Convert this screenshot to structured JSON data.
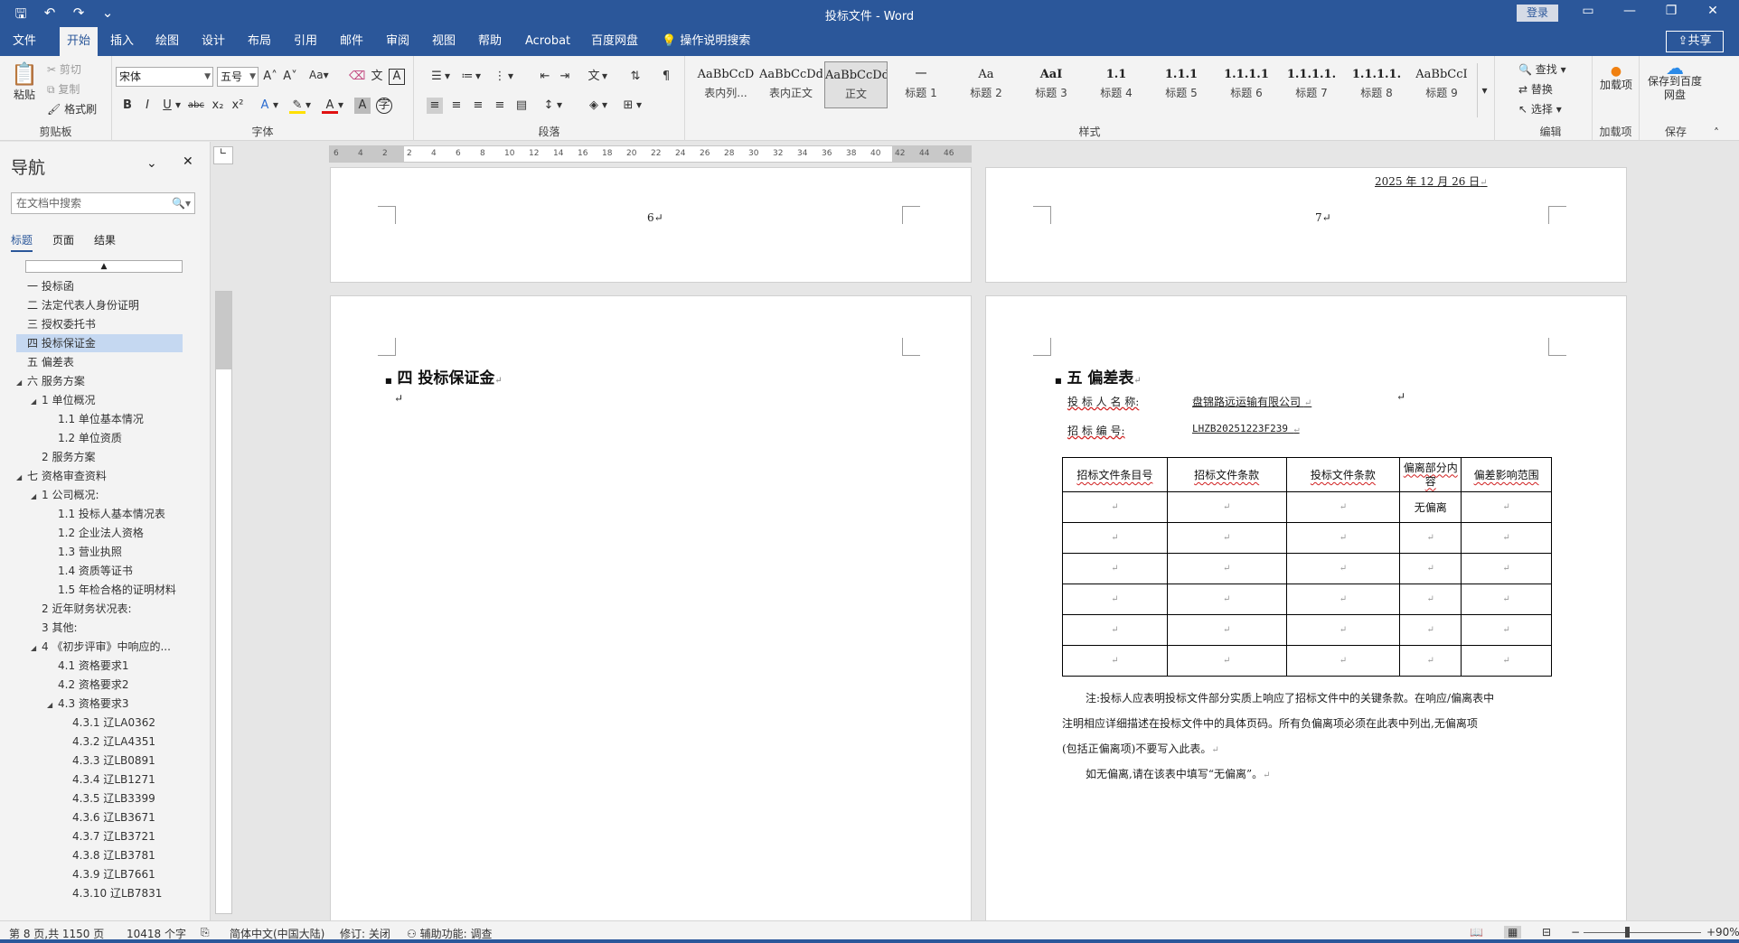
{
  "titlebar": {
    "title": "投标文件 - Word",
    "login_label": "登录",
    "qat_icons": [
      "save-icon",
      "undo-icon",
      "redo-icon",
      "customize-icon"
    ]
  },
  "tabs": {
    "items": [
      "文件",
      "开始",
      "插入",
      "绘图",
      "设计",
      "布局",
      "引用",
      "邮件",
      "审阅",
      "视图",
      "帮助",
      "Acrobat",
      "百度网盘"
    ],
    "active": "开始",
    "search_label": "操作说明搜索",
    "share_label": "共享"
  },
  "ribbon": {
    "clipboard": {
      "paste": "粘贴",
      "cut": "剪切",
      "copy": "复制",
      "format_painter": "格式刷",
      "label": "剪贴板"
    },
    "font": {
      "name": "宋体",
      "size": "五号",
      "label": "字体",
      "change_case": "Aa"
    },
    "paragraph": {
      "label": "段落"
    },
    "styles": {
      "label": "样式",
      "items": [
        {
          "sample": "AaBbCcD",
          "name": "表内列..."
        },
        {
          "sample": "AaBbCcDdI",
          "name": "表内正文"
        },
        {
          "sample": "AaBbCcDdI",
          "name": "正文"
        },
        {
          "sample": "一",
          "name": "标题 1"
        },
        {
          "sample": "Aa",
          "name": "标题 2"
        },
        {
          "sample": "AaI",
          "name": "标题 3"
        },
        {
          "sample": "1.1",
          "name": "标题 4"
        },
        {
          "sample": "1.1.1",
          "name": "标题 5"
        },
        {
          "sample": "1.1.1.1",
          "name": "标题 6"
        },
        {
          "sample": "1.1.1.1.",
          "name": "标题 7"
        },
        {
          "sample": "1.1.1.1.",
          "name": "标题 8"
        },
        {
          "sample": "AaBbCcI",
          "name": "标题 9"
        },
        {
          "sample": "AaBbCcDc",
          "name": ""
        }
      ]
    },
    "editing": {
      "find": "查找",
      "replace": "替换",
      "select": "选择",
      "label": "编辑"
    },
    "addin": {
      "add": "加载项",
      "label": "加载项"
    },
    "save": {
      "save_to_baidu": "保存到百度网盘",
      "label": "保存"
    }
  },
  "nav": {
    "title": "导航",
    "search_placeholder": "在文档中搜索",
    "tabs": [
      "标题",
      "页面",
      "结果"
    ],
    "items": [
      {
        "text": "一 投标函",
        "level": 0,
        "tri": ""
      },
      {
        "text": "二 法定代表人身份证明",
        "level": 0,
        "tri": ""
      },
      {
        "text": "三 授权委托书",
        "level": 0,
        "tri": ""
      },
      {
        "text": "四 投标保证金",
        "level": 0,
        "tri": "",
        "selected": true
      },
      {
        "text": "五 偏差表",
        "level": 0,
        "tri": ""
      },
      {
        "text": "六 服务方案",
        "level": 0,
        "tri": "◢"
      },
      {
        "text": "1 单位概况",
        "level": 1,
        "tri": "◢"
      },
      {
        "text": "1.1 单位基本情况",
        "level": 2,
        "tri": ""
      },
      {
        "text": "1.2 单位资质",
        "level": 2,
        "tri": ""
      },
      {
        "text": "2 服务方案",
        "level": 1,
        "tri": ""
      },
      {
        "text": "七 资格审查资料",
        "level": 0,
        "tri": "◢"
      },
      {
        "text": "1 公司概况:",
        "level": 1,
        "tri": "◢"
      },
      {
        "text": "1.1 投标人基本情况表",
        "level": 2,
        "tri": ""
      },
      {
        "text": "1.2 企业法人资格",
        "level": 2,
        "tri": ""
      },
      {
        "text": "1.3 营业执照",
        "level": 2,
        "tri": ""
      },
      {
        "text": "1.4 资质等证书",
        "level": 2,
        "tri": ""
      },
      {
        "text": "1.5 年检合格的证明材料",
        "level": 2,
        "tri": ""
      },
      {
        "text": "2 近年财务状况表:",
        "level": 1,
        "tri": ""
      },
      {
        "text": "3 其他:",
        "level": 1,
        "tri": ""
      },
      {
        "text": "4 《初步评审》中响应的...",
        "level": 1,
        "tri": "◢"
      },
      {
        "text": "4.1 资格要求1",
        "level": 2,
        "tri": ""
      },
      {
        "text": "4.2 资格要求2",
        "level": 2,
        "tri": ""
      },
      {
        "text": "4.3 资格要求3",
        "level": 2,
        "tri": "◢"
      },
      {
        "text": "4.3.1 辽LA0362",
        "level": 3,
        "tri": ""
      },
      {
        "text": "4.3.2 辽LA4351",
        "level": 3,
        "tri": ""
      },
      {
        "text": "4.3.3 辽LB0891",
        "level": 3,
        "tri": ""
      },
      {
        "text": "4.3.4 辽LB1271",
        "level": 3,
        "tri": ""
      },
      {
        "text": "4.3.5 辽LB3399",
        "level": 3,
        "tri": ""
      },
      {
        "text": "4.3.6 辽LB3671",
        "level": 3,
        "tri": ""
      },
      {
        "text": "4.3.7 辽LB3721",
        "level": 3,
        "tri": ""
      },
      {
        "text": "4.3.8 辽LB3781",
        "level": 3,
        "tri": ""
      },
      {
        "text": "4.3.9 辽LB7661",
        "level": 3,
        "tri": ""
      },
      {
        "text": "4.3.10 辽LB7831",
        "level": 3,
        "tri": ""
      }
    ]
  },
  "ruler": {
    "ticks": [
      "6",
      "4",
      "2",
      "2",
      "4",
      "6",
      "8",
      "10",
      "12",
      "14",
      "16",
      "18",
      "20",
      "22",
      "24",
      "26",
      "28",
      "30",
      "32",
      "34",
      "36",
      "38",
      "40",
      "42",
      "44",
      "46"
    ]
  },
  "document": {
    "page6_number": "6",
    "page7_number": "7",
    "page7_date": "2025 年 12 月 26 日",
    "page8_heading": "四 投标保证金",
    "page9_heading": "五 偏差表",
    "bidder_label": "投 标 人 名 称:",
    "bidder_value": "盘锦路远运输有限公司",
    "bid_no_label": "招 标 编 号:",
    "bid_no_value": "LHZB20251223F239",
    "table_headers": [
      "招标文件条目号",
      "招标文件条款",
      "投标文件条款",
      "偏离部分内容",
      "偏差影响范围"
    ],
    "first_row_deviation": "无偏离",
    "note_line1": "注:投标人应表明投标文件部分实质上响应了招标文件中的关键条款。在响应/偏离表中",
    "note_line2": "注明相应详细描述在投标文件中的具体页码。所有负偏离项必须在此表中列出,无偏离项",
    "note_line3": "(包括正偏离项)不要写入此表。",
    "note_line4": "如无偏离,请在该表中填写“无偏离”。",
    "paragraph_mark": "↵"
  },
  "status": {
    "page": "第 8 页,共 1150 页",
    "words": "10418 个字",
    "language": "简体中文(中国大陆)",
    "track": "修订: 关闭",
    "accessibility": "辅助功能: 调查",
    "zoom": "90%"
  },
  "colors": {
    "accent": "#2b579a",
    "ribbon_bg": "#f3f3f3",
    "nav_selected": "#c5d8f1"
  }
}
